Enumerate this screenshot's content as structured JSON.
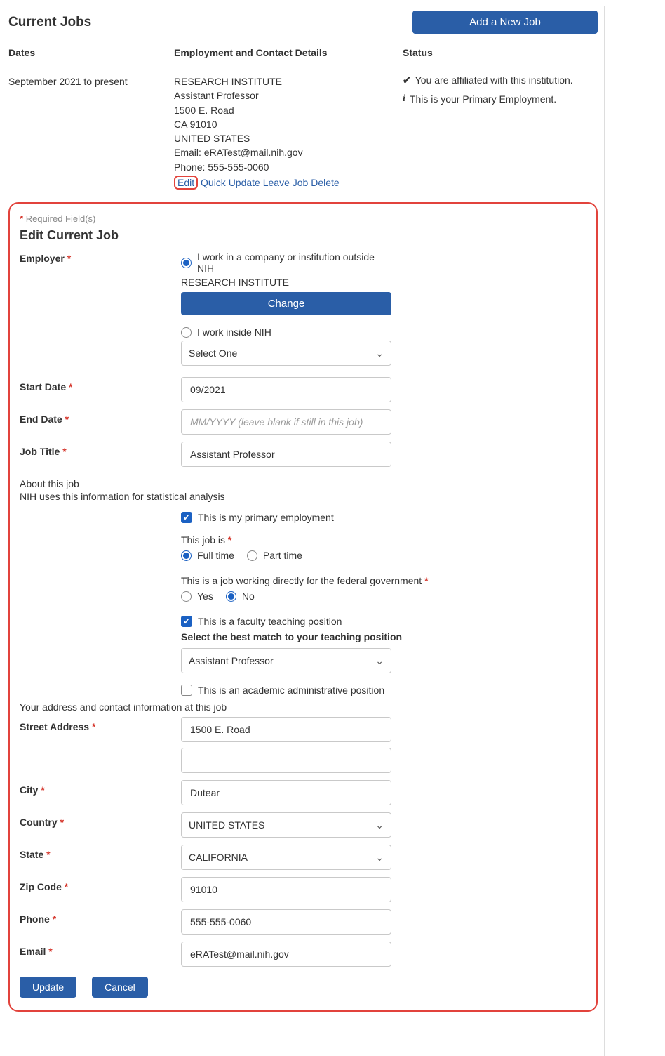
{
  "header": {
    "title": "Current Jobs",
    "add_button_label": "Add a New Job",
    "col_dates": "Dates",
    "col_details": "Employment and Contact Details",
    "col_status": "Status"
  },
  "job": {
    "dates": "September 2021 to present",
    "institution": "RESEARCH INSTITUTE",
    "title": "Assistant Professor",
    "street": "1500 E. Road",
    "region": "CA 91010",
    "country": "UNITED STATES",
    "email_label": "Email: eRATest@mail.nih.gov",
    "phone_label": "Phone: 555-555-0060",
    "actions": {
      "edit": "Edit",
      "quick_update": "Quick Update",
      "leave": "Leave Job",
      "delete": "Delete"
    },
    "status_affiliated": "You are affiliated with this institution.",
    "status_primary": "This is your Primary Employment."
  },
  "form": {
    "required_note": "Required Field(s)",
    "title": "Edit Current Job",
    "labels": {
      "employer": "Employer",
      "start_date": "Start Date",
      "end_date": "End Date",
      "job_title": "Job Title",
      "street": "Street Address",
      "city": "City",
      "country": "Country",
      "state": "State",
      "zip": "Zip Code",
      "phone": "Phone",
      "email": "Email"
    },
    "employer": {
      "opt_outside": "I work in a company or institution outside NIH",
      "institution": "RESEARCH INSTITUTE",
      "change_label": "Change",
      "opt_inside": "I work inside NIH",
      "inside_placeholder": "Select One"
    },
    "start_date_value": "09/2021",
    "end_date_placeholder": "MM/YYYY (leave blank if still in this job)",
    "job_title_value": "Assistant Professor",
    "about_heading": "About this job",
    "about_note": "NIH uses this information for statistical analysis",
    "primary_label": "This is my primary employment",
    "this_job_is_label": "This job is",
    "full_time": "Full time",
    "part_time": "Part time",
    "federal_question": "This is a job working directly for the federal government",
    "yes": "Yes",
    "no": "No",
    "faculty_label": "This is a faculty teaching position",
    "teaching_match_label": "Select the best match to your teaching position",
    "teaching_value": "Assistant Professor",
    "academic_admin_label": "This is an academic administrative position",
    "address_heading": "Your address and contact information at this job",
    "street_value": "1500 E. Road",
    "street2_value": "",
    "city_value": "Dutear",
    "country_value": "UNITED STATES",
    "state_value": "CALIFORNIA",
    "zip_value": "91010",
    "phone_value": "555-555-0060",
    "email_value": "eRATest@mail.nih.gov",
    "update_label": "Update",
    "cancel_label": "Cancel"
  }
}
